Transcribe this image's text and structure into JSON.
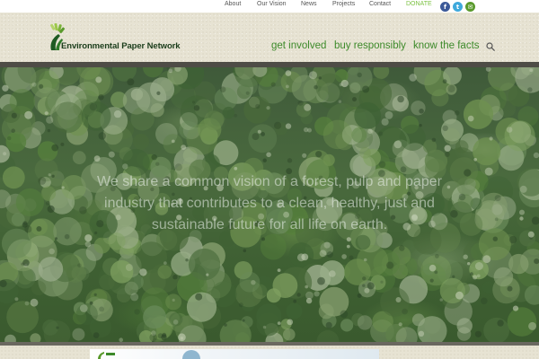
{
  "topnav": {
    "about": "About",
    "our_vision": "Our Vision",
    "news": "News",
    "projects": "Projects",
    "contact": "Contact",
    "donate": "DONATE"
  },
  "social": {
    "facebook_glyph": "f",
    "twitter_glyph": "t",
    "email_glyph": "✉",
    "facebook_color": "#3b5998",
    "twitter_color": "#3fa9dc",
    "email_color": "#5a9a2c"
  },
  "logo": {
    "name": "Environmental Paper Network"
  },
  "mainnav": {
    "get_involved": "get involved",
    "buy_responsibly": "buy responsibly",
    "know_the_facts": "know the facts"
  },
  "hero": {
    "statement": "We share a common vision of a forest, pulp and paper industry that contributes to a clean, healthy, just and sustainable future for all life on earth."
  },
  "colors": {
    "nav_green": "#3d8a2a",
    "donate_green": "#7cc243",
    "header_bg": "#e7e3d3",
    "divider": "#4e4c46"
  }
}
